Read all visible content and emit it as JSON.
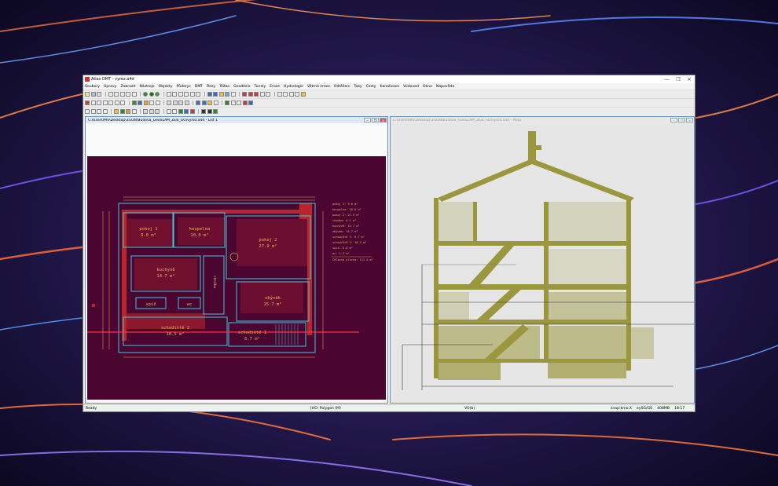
{
  "app": {
    "title": "Atlas DMT - vyrez.a4d",
    "window_controls": [
      "—",
      "❐",
      "✕"
    ]
  },
  "menu": [
    "Soubory",
    "Úpravy",
    "Zobrazit",
    "Nástroje",
    "Objekty",
    "Půdorys",
    "DMT",
    "Řezy",
    "Těžba",
    "Geodézie",
    "Tunely",
    "Eroze",
    "Hydrologie",
    "Větrná eroze",
    "Odtěžení",
    "Toky",
    "Cesty",
    "Kanalizace",
    "Vodovod",
    "Okno",
    "Nápověda"
  ],
  "left_window": {
    "title": "C:\\Users\\MS\\Desktop\\3GON\\Budova_GeoSLAM_ZEB_GO\\vyrez.a4d - List 1",
    "rooms": [
      {
        "name": "pokoj 1",
        "area": "9.0 m²"
      },
      {
        "name": "koupelna",
        "area": "10.0 m²"
      },
      {
        "name": "pokoj 2",
        "area": "27.9 m²"
      },
      {
        "name": "kuchyně",
        "area": "14.7 m²"
      },
      {
        "name": "chodba",
        "area": "6.1 m²"
      },
      {
        "name": "spíž",
        "area": "2.0 m²"
      },
      {
        "name": "wc",
        "area": "1.2 m²"
      },
      {
        "name": "obývák",
        "area": "15.7 m²"
      },
      {
        "name": "schodiště 2",
        "area": "18.5 m²"
      },
      {
        "name": "schodiště 1",
        "area": "6.7 m²"
      }
    ],
    "legend": [
      "pokoj 1: 9.0 m²",
      "koupelna: 10.0 m²",
      "pokoj 2: 27.9 m²",
      "chodba: 6.1 m²",
      "kuchyně: 14.7 m²",
      "obývák: 15.7 m²",
      "schodiště 1: 6.7 m²",
      "schodiště 2: 18.5 m²",
      "spíž: 2.0 m²",
      "wc: 1.2 m²",
      "Celková plocha: 112.0 m²"
    ]
  },
  "right_window": {
    "title": "C:\\Users\\MS\\Desktop\\3GON\\Budova_GeoSLAM_ZEB_GO\\vyrez.a4d - Řezy"
  },
  "status": {
    "ready": "Ready",
    "mode": "[HO: Polygon (M)",
    "vo": "VO(b)",
    "snap": "snap:kmo.X",
    "coord_sys": "eySG/G0",
    "memory": "408MB",
    "time": "18:17"
  },
  "colors": {
    "plan_bg": "#4a0530",
    "wall": "#45c8d8",
    "points_red": "#e0302a",
    "dim": "#e8b060",
    "cloud_olive": "#8f8a22"
  }
}
